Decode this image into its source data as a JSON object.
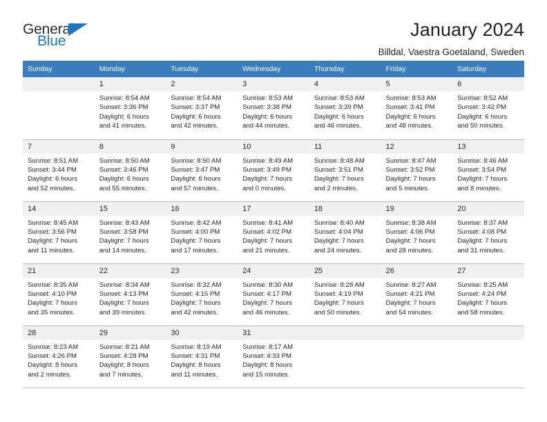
{
  "logo": {
    "word_one": "General",
    "word_two": "Blue",
    "triangle_icon": "triangle-icon",
    "brand_color": "#1b76bc"
  },
  "header": {
    "title": "January 2024",
    "subtitle": "Billdal, Vaestra Goetaland, Sweden"
  },
  "calendar": {
    "header_bg": "#3b7dbd",
    "daynum_bg": "#f0f0f0",
    "weekday_headers": [
      "Sunday",
      "Monday",
      "Tuesday",
      "Wednesday",
      "Thursday",
      "Friday",
      "Saturday"
    ],
    "weeks": [
      [
        {
          "day": "",
          "sunrise": "",
          "sunset": "",
          "daylight_line1": "",
          "daylight_line2": "",
          "empty": true
        },
        {
          "day": "1",
          "sunrise": "Sunrise: 8:54 AM",
          "sunset": "Sunset: 3:36 PM",
          "daylight_line1": "Daylight: 6 hours",
          "daylight_line2": "and 41 minutes.",
          "empty": false
        },
        {
          "day": "2",
          "sunrise": "Sunrise: 8:54 AM",
          "sunset": "Sunset: 3:37 PM",
          "daylight_line1": "Daylight: 6 hours",
          "daylight_line2": "and 42 minutes.",
          "empty": false
        },
        {
          "day": "3",
          "sunrise": "Sunrise: 8:53 AM",
          "sunset": "Sunset: 3:38 PM",
          "daylight_line1": "Daylight: 6 hours",
          "daylight_line2": "and 44 minutes.",
          "empty": false
        },
        {
          "day": "4",
          "sunrise": "Sunrise: 8:53 AM",
          "sunset": "Sunset: 3:39 PM",
          "daylight_line1": "Daylight: 6 hours",
          "daylight_line2": "and 46 minutes.",
          "empty": false
        },
        {
          "day": "5",
          "sunrise": "Sunrise: 8:53 AM",
          "sunset": "Sunset: 3:41 PM",
          "daylight_line1": "Daylight: 6 hours",
          "daylight_line2": "and 48 minutes.",
          "empty": false
        },
        {
          "day": "6",
          "sunrise": "Sunrise: 8:52 AM",
          "sunset": "Sunset: 3:42 PM",
          "daylight_line1": "Daylight: 6 hours",
          "daylight_line2": "and 50 minutes.",
          "empty": false
        }
      ],
      [
        {
          "day": "7",
          "sunrise": "Sunrise: 8:51 AM",
          "sunset": "Sunset: 3:44 PM",
          "daylight_line1": "Daylight: 6 hours",
          "daylight_line2": "and 52 minutes.",
          "empty": false
        },
        {
          "day": "8",
          "sunrise": "Sunrise: 8:50 AM",
          "sunset": "Sunset: 3:46 PM",
          "daylight_line1": "Daylight: 6 hours",
          "daylight_line2": "and 55 minutes.",
          "empty": false
        },
        {
          "day": "9",
          "sunrise": "Sunrise: 8:50 AM",
          "sunset": "Sunset: 3:47 PM",
          "daylight_line1": "Daylight: 6 hours",
          "daylight_line2": "and 57 minutes.",
          "empty": false
        },
        {
          "day": "10",
          "sunrise": "Sunrise: 8:49 AM",
          "sunset": "Sunset: 3:49 PM",
          "daylight_line1": "Daylight: 7 hours",
          "daylight_line2": "and 0 minutes.",
          "empty": false
        },
        {
          "day": "11",
          "sunrise": "Sunrise: 8:48 AM",
          "sunset": "Sunset: 3:51 PM",
          "daylight_line1": "Daylight: 7 hours",
          "daylight_line2": "and 2 minutes.",
          "empty": false
        },
        {
          "day": "12",
          "sunrise": "Sunrise: 8:47 AM",
          "sunset": "Sunset: 3:52 PM",
          "daylight_line1": "Daylight: 7 hours",
          "daylight_line2": "and 5 minutes.",
          "empty": false
        },
        {
          "day": "13",
          "sunrise": "Sunrise: 8:46 AM",
          "sunset": "Sunset: 3:54 PM",
          "daylight_line1": "Daylight: 7 hours",
          "daylight_line2": "and 8 minutes.",
          "empty": false
        }
      ],
      [
        {
          "day": "14",
          "sunrise": "Sunrise: 8:45 AM",
          "sunset": "Sunset: 3:56 PM",
          "daylight_line1": "Daylight: 7 hours",
          "daylight_line2": "and 11 minutes.",
          "empty": false
        },
        {
          "day": "15",
          "sunrise": "Sunrise: 8:43 AM",
          "sunset": "Sunset: 3:58 PM",
          "daylight_line1": "Daylight: 7 hours",
          "daylight_line2": "and 14 minutes.",
          "empty": false
        },
        {
          "day": "16",
          "sunrise": "Sunrise: 8:42 AM",
          "sunset": "Sunset: 4:00 PM",
          "daylight_line1": "Daylight: 7 hours",
          "daylight_line2": "and 17 minutes.",
          "empty": false
        },
        {
          "day": "17",
          "sunrise": "Sunrise: 8:41 AM",
          "sunset": "Sunset: 4:02 PM",
          "daylight_line1": "Daylight: 7 hours",
          "daylight_line2": "and 21 minutes.",
          "empty": false
        },
        {
          "day": "18",
          "sunrise": "Sunrise: 8:40 AM",
          "sunset": "Sunset: 4:04 PM",
          "daylight_line1": "Daylight: 7 hours",
          "daylight_line2": "and 24 minutes.",
          "empty": false
        },
        {
          "day": "19",
          "sunrise": "Sunrise: 8:38 AM",
          "sunset": "Sunset: 4:06 PM",
          "daylight_line1": "Daylight: 7 hours",
          "daylight_line2": "and 28 minutes.",
          "empty": false
        },
        {
          "day": "20",
          "sunrise": "Sunrise: 8:37 AM",
          "sunset": "Sunset: 4:08 PM",
          "daylight_line1": "Daylight: 7 hours",
          "daylight_line2": "and 31 minutes.",
          "empty": false
        }
      ],
      [
        {
          "day": "21",
          "sunrise": "Sunrise: 8:35 AM",
          "sunset": "Sunset: 4:10 PM",
          "daylight_line1": "Daylight: 7 hours",
          "daylight_line2": "and 35 minutes.",
          "empty": false
        },
        {
          "day": "22",
          "sunrise": "Sunrise: 8:34 AM",
          "sunset": "Sunset: 4:13 PM",
          "daylight_line1": "Daylight: 7 hours",
          "daylight_line2": "and 39 minutes.",
          "empty": false
        },
        {
          "day": "23",
          "sunrise": "Sunrise: 8:32 AM",
          "sunset": "Sunset: 4:15 PM",
          "daylight_line1": "Daylight: 7 hours",
          "daylight_line2": "and 42 minutes.",
          "empty": false
        },
        {
          "day": "24",
          "sunrise": "Sunrise: 8:30 AM",
          "sunset": "Sunset: 4:17 PM",
          "daylight_line1": "Daylight: 7 hours",
          "daylight_line2": "and 46 minutes.",
          "empty": false
        },
        {
          "day": "25",
          "sunrise": "Sunrise: 8:28 AM",
          "sunset": "Sunset: 4:19 PM",
          "daylight_line1": "Daylight: 7 hours",
          "daylight_line2": "and 50 minutes.",
          "empty": false
        },
        {
          "day": "26",
          "sunrise": "Sunrise: 8:27 AM",
          "sunset": "Sunset: 4:21 PM",
          "daylight_line1": "Daylight: 7 hours",
          "daylight_line2": "and 54 minutes.",
          "empty": false
        },
        {
          "day": "27",
          "sunrise": "Sunrise: 8:25 AM",
          "sunset": "Sunset: 4:24 PM",
          "daylight_line1": "Daylight: 7 hours",
          "daylight_line2": "and 58 minutes.",
          "empty": false
        }
      ],
      [
        {
          "day": "28",
          "sunrise": "Sunrise: 8:23 AM",
          "sunset": "Sunset: 4:26 PM",
          "daylight_line1": "Daylight: 8 hours",
          "daylight_line2": "and 2 minutes.",
          "empty": false
        },
        {
          "day": "29",
          "sunrise": "Sunrise: 8:21 AM",
          "sunset": "Sunset: 4:28 PM",
          "daylight_line1": "Daylight: 8 hours",
          "daylight_line2": "and 7 minutes.",
          "empty": false
        },
        {
          "day": "30",
          "sunrise": "Sunrise: 8:19 AM",
          "sunset": "Sunset: 4:31 PM",
          "daylight_line1": "Daylight: 8 hours",
          "daylight_line2": "and 11 minutes.",
          "empty": false
        },
        {
          "day": "31",
          "sunrise": "Sunrise: 8:17 AM",
          "sunset": "Sunset: 4:33 PM",
          "daylight_line1": "Daylight: 8 hours",
          "daylight_line2": "and 15 minutes.",
          "empty": false
        },
        {
          "day": "",
          "sunrise": "",
          "sunset": "",
          "daylight_line1": "",
          "daylight_line2": "",
          "empty": true
        },
        {
          "day": "",
          "sunrise": "",
          "sunset": "",
          "daylight_line1": "",
          "daylight_line2": "",
          "empty": true
        },
        {
          "day": "",
          "sunrise": "",
          "sunset": "",
          "daylight_line1": "",
          "daylight_line2": "",
          "empty": true
        }
      ]
    ]
  }
}
